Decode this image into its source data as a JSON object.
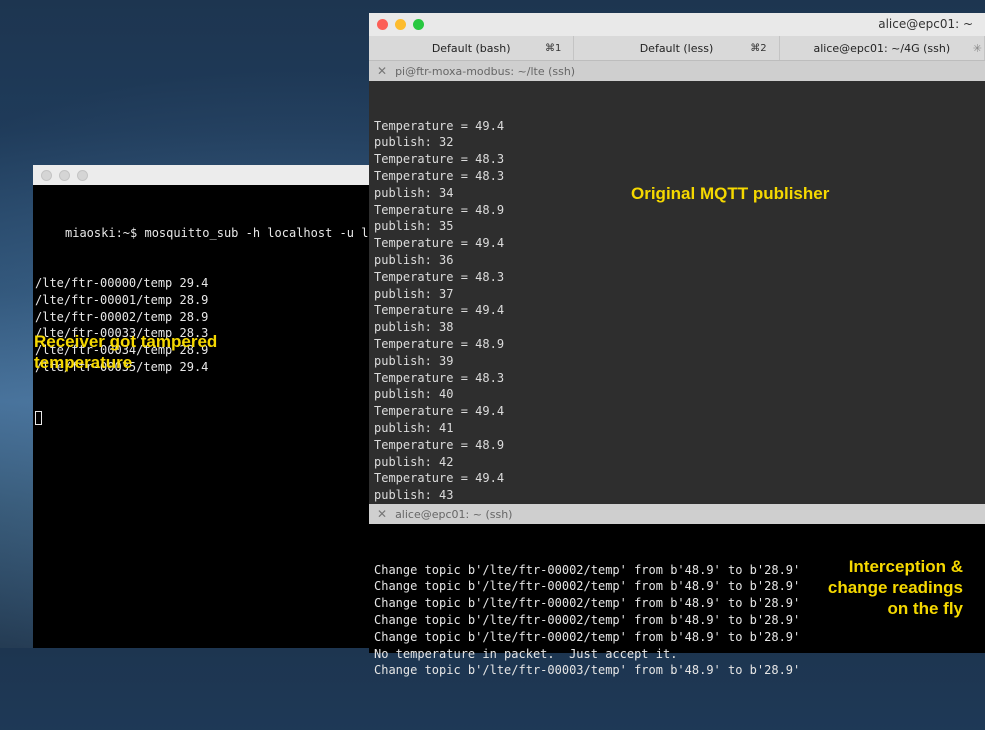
{
  "left_window": {
    "prompt": "miaoski:~$ mosquitto_sub -h localhost -u lt",
    "lines": [
      "/lte/ftr-00000/temp 29.4",
      "/lte/ftr-00001/temp 28.9",
      "/lte/ftr-00002/temp 28.9",
      "/lte/ftr-00033/temp 28.3",
      "/lte/ftr-00034/temp 28.9",
      "/lte/ftr-00035/temp 29.4"
    ],
    "annotation": "Receiver got tampered\ntemperature"
  },
  "right_window": {
    "title": "alice@epc01: ~",
    "tabs": [
      {
        "label": "Default (bash)",
        "shortcut": "⌘1"
      },
      {
        "label": "Default (less)",
        "shortcut": "⌘2"
      },
      {
        "label": "alice@epc01: ~/4G (ssh)",
        "shortcut": ""
      }
    ],
    "pane1": {
      "header": "pi@ftr-moxa-modbus: ~/lte (ssh)",
      "lines": [
        "Temperature = 49.4",
        "publish: 32",
        "Temperature = 48.3",
        "Temperature = 48.3",
        "publish: 34",
        "Temperature = 48.9",
        "publish: 35",
        "Temperature = 49.4",
        "publish: 36",
        "Temperature = 48.3",
        "publish: 37",
        "Temperature = 49.4",
        "publish: 38",
        "Temperature = 48.9",
        "publish: 39",
        "Temperature = 48.3",
        "publish: 40",
        "Temperature = 49.4",
        "publish: 41",
        "Temperature = 48.9",
        "publish: 42",
        "Temperature = 49.4",
        "publish: 43"
      ],
      "annotation": "Original MQTT publisher"
    },
    "pane2": {
      "header": "alice@epc01: ~ (ssh)",
      "lines": [
        "Change topic b'/lte/ftr-00002/temp' from b'48.9' to b'28.9'",
        "Change topic b'/lte/ftr-00002/temp' from b'48.9' to b'28.9'",
        "Change topic b'/lte/ftr-00002/temp' from b'48.9' to b'28.9'",
        "Change topic b'/lte/ftr-00002/temp' from b'48.9' to b'28.9'",
        "Change topic b'/lte/ftr-00002/temp' from b'48.9' to b'28.9'",
        "No temperature in packet.  Just accept it.",
        "Change topic b'/lte/ftr-00003/temp' from b'48.9' to b'28.9'"
      ],
      "annotation": "Interception &\nchange readings\non the fly"
    }
  },
  "colors": {
    "annotation": "#f5d800",
    "pane_bg": "#2e2e2e",
    "terminal_bg": "#000000"
  }
}
